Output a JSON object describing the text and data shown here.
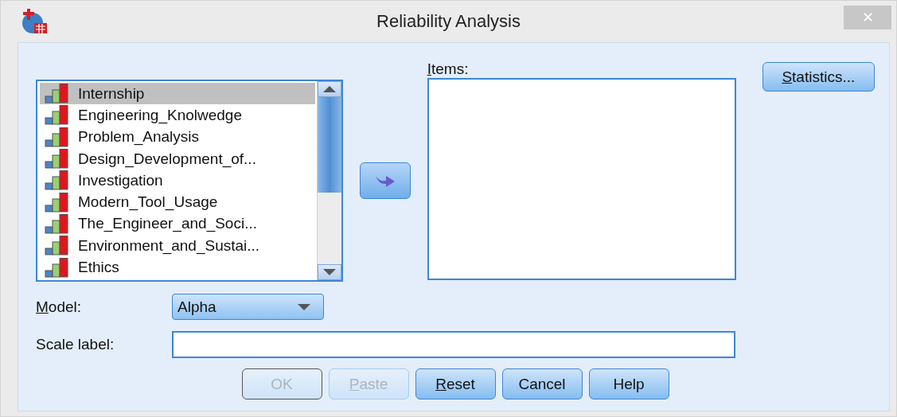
{
  "window": {
    "title": "Reliability Analysis",
    "close": "✕"
  },
  "variables": [
    {
      "label": "Internship",
      "selected": true
    },
    {
      "label": "Engineering_Knolwedge",
      "selected": false
    },
    {
      "label": "Problem_Analysis",
      "selected": false
    },
    {
      "label": "Design_Development_of...",
      "selected": false
    },
    {
      "label": "Investigation",
      "selected": false
    },
    {
      "label": "Modern_Tool_Usage",
      "selected": false
    },
    {
      "label": "The_Engineer_and_Soci...",
      "selected": false
    },
    {
      "label": "Environment_and_Sustai...",
      "selected": false
    },
    {
      "label": "Ethics",
      "selected": false
    }
  ],
  "items": {
    "label": "Items:",
    "mnemonic": true
  },
  "statistics_button": {
    "label": "Statistics...",
    "mnemonic": true
  },
  "model": {
    "label": "Model:",
    "mnemonic": true,
    "value": "Alpha"
  },
  "scale_label": {
    "label": "Scale label:"
  },
  "buttons": [
    {
      "label": "OK",
      "disabled": true,
      "mnemonic": false
    },
    {
      "label": "Paste",
      "disabled": true,
      "mnemonic": true
    },
    {
      "label": "Reset",
      "disabled": false,
      "mnemonic": true
    },
    {
      "label": "Cancel",
      "disabled": false,
      "mnemonic": false
    },
    {
      "label": "Help",
      "disabled": false,
      "mnemonic": false
    }
  ]
}
